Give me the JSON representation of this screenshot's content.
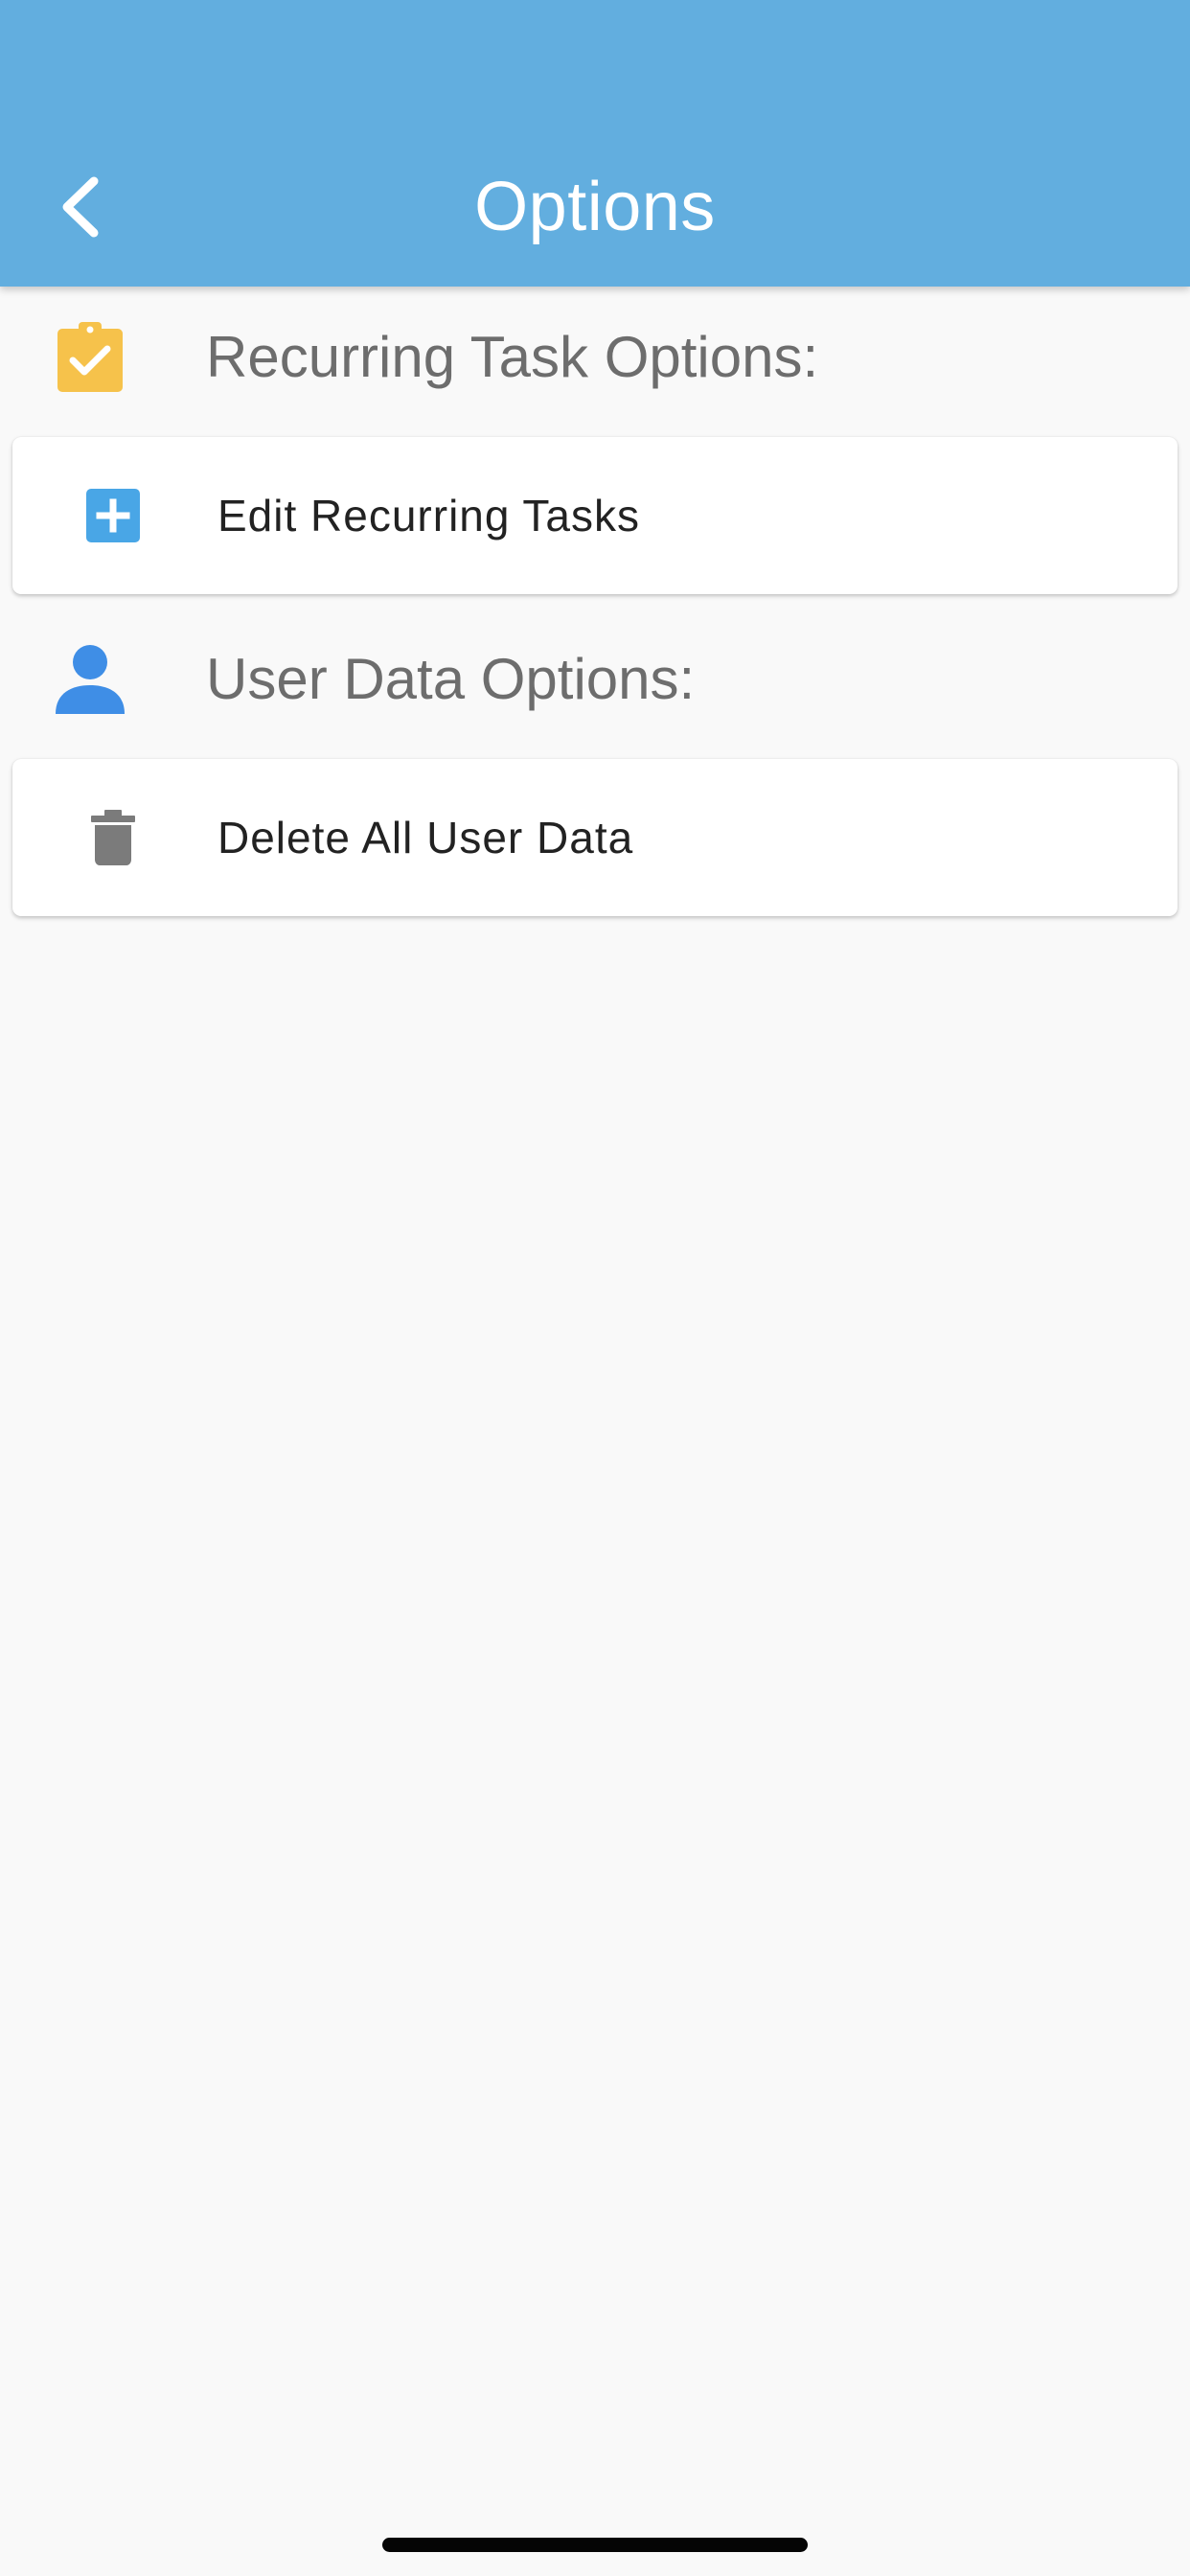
{
  "header": {
    "title": "Options",
    "background_color": "#62aedf",
    "back_icon": "chevron-left-icon"
  },
  "sections": [
    {
      "title": "Recurring Task Options:",
      "icon": "clipboard-check-icon",
      "icon_color": "#f6c24b",
      "items": [
        {
          "label": "Edit Recurring Tasks",
          "icon": "plus-box-icon",
          "icon_color": "#49a6e6"
        }
      ]
    },
    {
      "title": "User Data Options:",
      "icon": "person-icon",
      "icon_color": "#3f8ee6",
      "items": [
        {
          "label": "Delete All User Data",
          "icon": "trash-icon",
          "icon_color": "#7b7b7b"
        }
      ]
    }
  ]
}
